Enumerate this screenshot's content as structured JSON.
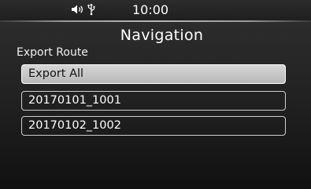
{
  "status": {
    "time": "10:00",
    "icons": [
      "volume-icon",
      "usb-icon"
    ]
  },
  "screen": {
    "title": "Navigation",
    "section_label": "Export Route"
  },
  "list": {
    "items": [
      {
        "label": "Export All",
        "selected": true
      },
      {
        "label": "20170101_1001",
        "selected": false
      },
      {
        "label": "20170102_1002",
        "selected": false
      }
    ]
  }
}
